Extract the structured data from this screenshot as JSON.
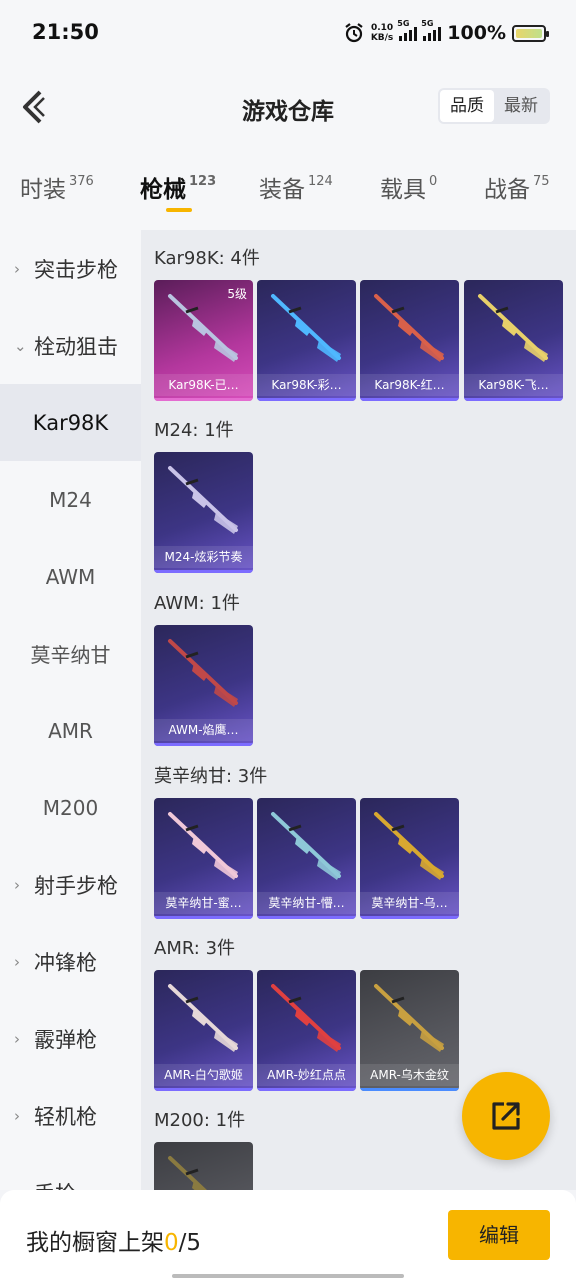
{
  "status_bar": {
    "time": "21:50",
    "speed_value": "0.10",
    "speed_unit": "KB/s",
    "net1": "5G",
    "net2": "5G",
    "battery": "100%"
  },
  "header": {
    "title": "游戏仓库",
    "sort_options": [
      "品质",
      "最新"
    ]
  },
  "tabs": [
    {
      "label": "时装",
      "count": "376"
    },
    {
      "label": "枪械",
      "count": "123"
    },
    {
      "label": "装备",
      "count": "124"
    },
    {
      "label": "载具",
      "count": "0"
    },
    {
      "label": "战备",
      "count": "75"
    }
  ],
  "sidebar": [
    {
      "label": "突击步枪",
      "type": "group",
      "chevron": "›"
    },
    {
      "label": "栓动狙击",
      "type": "group",
      "chevron": "⌄"
    },
    {
      "label": "Kar98K",
      "type": "sub",
      "selected": true
    },
    {
      "label": "M24",
      "type": "sub"
    },
    {
      "label": "AWM",
      "type": "sub"
    },
    {
      "label": "莫辛纳甘",
      "type": "sub"
    },
    {
      "label": "AMR",
      "type": "sub"
    },
    {
      "label": "M200",
      "type": "sub"
    },
    {
      "label": "射手步枪",
      "type": "group",
      "chevron": "›"
    },
    {
      "label": "冲锋枪",
      "type": "group",
      "chevron": "›"
    },
    {
      "label": "霰弹枪",
      "type": "group",
      "chevron": "›"
    },
    {
      "label": "轻机枪",
      "type": "group",
      "chevron": "›"
    },
    {
      "label": "手枪",
      "type": "group",
      "chevron": "›"
    }
  ],
  "sections": [
    {
      "title": "Kar98K: 4件",
      "items": [
        {
          "name": "Kar98K-已…",
          "level": "5级",
          "style": "pink",
          "gun_color": "#b9c4e0"
        },
        {
          "name": "Kar98K-彩…",
          "style": "purple",
          "gun_color": "#4fb8ff"
        },
        {
          "name": "Kar98K-红…",
          "style": "purple",
          "gun_color": "#d9604a"
        },
        {
          "name": "Kar98K-飞…",
          "style": "purple",
          "gun_color": "#e8d06a"
        }
      ]
    },
    {
      "title": "M24: 1件",
      "items": [
        {
          "name": "M24-炫彩节奏",
          "style": "purple",
          "gun_color": "#c9c3e8"
        }
      ]
    },
    {
      "title": "AWM: 1件",
      "items": [
        {
          "name": "AWM-焰鹰…",
          "style": "purple",
          "gun_color": "#c04848"
        }
      ]
    },
    {
      "title": "莫辛纳甘: 3件",
      "items": [
        {
          "name": "莫辛纳甘-蜜…",
          "style": "purple",
          "gun_color": "#f0c8d8"
        },
        {
          "name": "莫辛纳甘-懵…",
          "style": "purple",
          "gun_color": "#8ec8d8"
        },
        {
          "name": "莫辛纳甘-乌…",
          "style": "purple",
          "gun_color": "#d8a830"
        }
      ]
    },
    {
      "title": "AMR: 3件",
      "items": [
        {
          "name": "AMR-白勺歌姬",
          "style": "purple",
          "gun_color": "#e6d8d8"
        },
        {
          "name": "AMR-妙红点点",
          "style": "purple",
          "gun_color": "#e04040"
        },
        {
          "name": "AMR-乌木金纹",
          "style": "gray",
          "gun_color": "#c8a040"
        }
      ]
    },
    {
      "title": "M200: 1件",
      "items": [
        {
          "name": "",
          "style": "gray",
          "gun_color": "#8a7a40"
        }
      ]
    }
  ],
  "fab_icon": "share-icon",
  "bottom_bar": {
    "label": "我的橱窗上架",
    "current": "0",
    "total": "/5",
    "edit_label": "编辑"
  },
  "colors": {
    "accent": "#f7b500"
  }
}
